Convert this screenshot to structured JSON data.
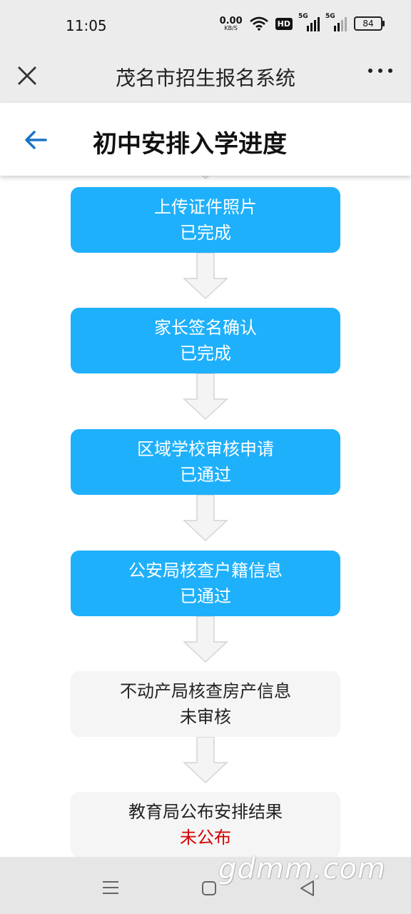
{
  "status_bar": {
    "time": "11:05",
    "net_speed_value": "0.00",
    "net_speed_unit": "KB/S",
    "hd_badge": "HD",
    "signal_1_label": "5G",
    "signal_2_label": "5G",
    "battery": "84"
  },
  "title_bar": {
    "title": "茂名市招生报名系统",
    "close_icon": "close-icon",
    "more_icon": "more-dots-icon"
  },
  "header": {
    "title": "初中安排入学进度",
    "back_icon": "arrow-left-icon",
    "accent_color": "#1a73c8"
  },
  "steps": [
    {
      "name": "上传证件照片",
      "status": "已完成",
      "state": "done"
    },
    {
      "name": "家长签名确认",
      "status": "已完成",
      "state": "done"
    },
    {
      "name": "区域学校审核申请",
      "status": "已通过",
      "state": "done"
    },
    {
      "name": "公安局核查户籍信息",
      "status": "已通过",
      "state": "done"
    },
    {
      "name": "不动产局核查房产信息",
      "status": "未审核",
      "state": "pending"
    },
    {
      "name": "教育局公布安排结果",
      "status": "未公布",
      "state": "unpublished"
    }
  ],
  "colors": {
    "step_done": "#1fb0fb",
    "step_pending": "#f5f5f5",
    "status_unpublished": "#d40000"
  },
  "nav_bar": {
    "menu_icon": "menu-icon",
    "home_icon": "square-home-icon",
    "back_icon": "triangle-back-icon"
  },
  "watermark": "gdmm.com"
}
